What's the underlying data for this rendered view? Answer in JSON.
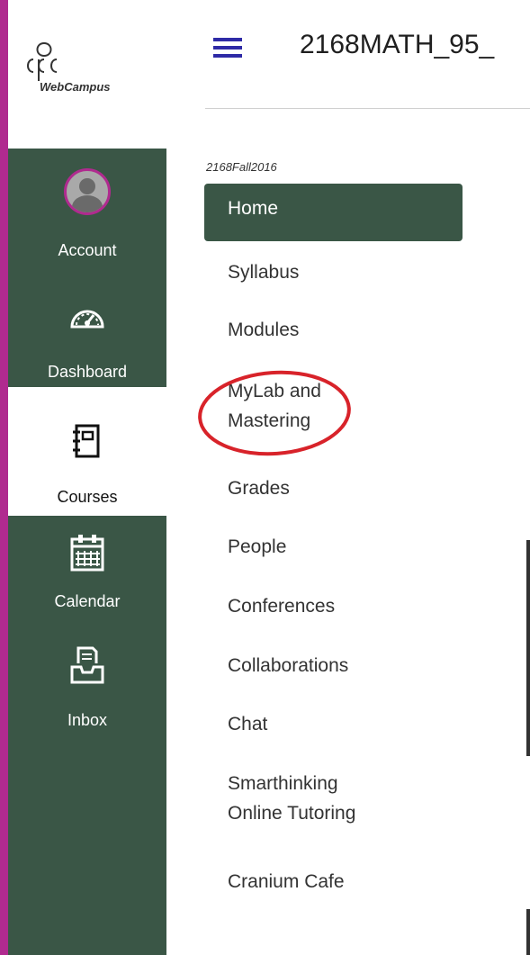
{
  "brand": {
    "logo_text": "WebCampus",
    "accent_color": "#b02a8f",
    "nav_color": "#3a5646"
  },
  "header": {
    "title": "2168MATH_95_"
  },
  "global_nav": [
    {
      "label": "Account",
      "icon": "avatar-icon"
    },
    {
      "label": "Dashboard",
      "icon": "speedometer-icon"
    },
    {
      "label": "Courses",
      "icon": "notebook-icon",
      "active": true
    },
    {
      "label": "Calendar",
      "icon": "calendar-icon"
    },
    {
      "label": "Inbox",
      "icon": "inbox-icon"
    }
  ],
  "course_nav": {
    "term": "2168Fall2016",
    "items": [
      {
        "label": "Home",
        "active": true
      },
      {
        "label": "Syllabus"
      },
      {
        "label": "Modules"
      },
      {
        "label": "MyLab and Mastering",
        "line1": "MyLab and",
        "line2": "Mastering",
        "highlighted": true
      },
      {
        "label": "Grades"
      },
      {
        "label": "People"
      },
      {
        "label": "Conferences"
      },
      {
        "label": "Collaborations"
      },
      {
        "label": "Chat"
      },
      {
        "label": "Smarthinking Online Tutoring",
        "line1": "Smarthinking",
        "line2": "Online Tutoring"
      },
      {
        "label": "Cranium Cafe"
      }
    ]
  }
}
